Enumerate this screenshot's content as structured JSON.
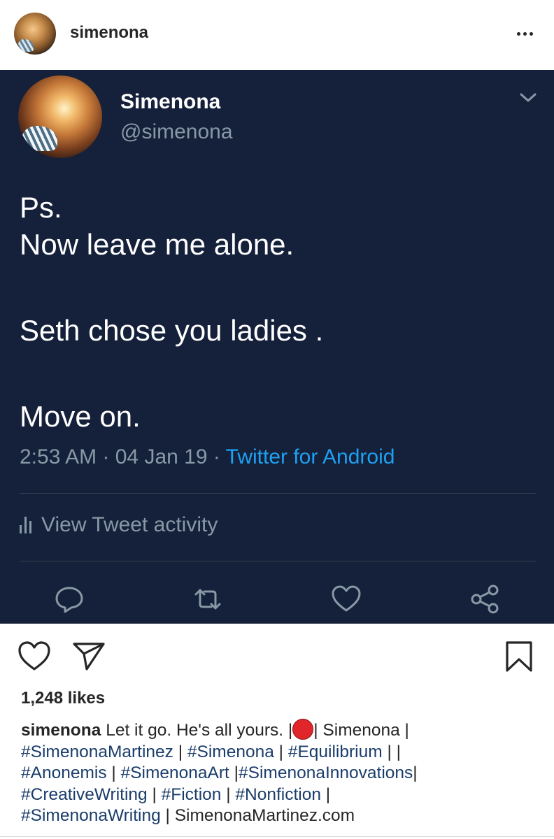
{
  "ig": {
    "username": "simenona",
    "likes": "1,248 likes"
  },
  "tweet": {
    "name": "Simenona",
    "handle": "@simenona",
    "lines": [
      "Ps.",
      "Now leave me alone.",
      "Seth chose you ladies .",
      "Move on."
    ],
    "time": "2:53 AM",
    "date": "04 Jan 19",
    "source": "Twitter for Android",
    "activity_label": "View Tweet activity",
    "separator": " · "
  },
  "caption": {
    "username": "simenona",
    "text1": "Let it go. He's all yours. |",
    "text2": "| Simenona |",
    "tag_martinez": "#SimenonaMartinez",
    "sep1": " | ",
    "tag_simenona": "#Simenona",
    "sep2": " | ",
    "tag_equilibrium": "#Equilibrium",
    "sep3": " | |",
    "tag_anonemis": "#Anonemis",
    "sep4": " | ",
    "tag_art": "#SimenonaArt",
    "sep5": " |",
    "tag_innovations": "#SimenonaInnovations",
    "sep6": "|",
    "tag_creative": "#CreativeWriting",
    "sep7": " | ",
    "tag_fiction": "#Fiction",
    "sep8": " | ",
    "tag_nonfiction": "#Nonfiction",
    "sep9": " |",
    "tag_writing": "#SimenonaWriting",
    "sep10": " | SimenonaMartinez.com"
  },
  "colors": {
    "tweet_bg": "#15203a",
    "twitter_blue": "#1da1f2",
    "muted": "#8899a6",
    "hashtag": "#1b3d6b",
    "red_dot": "#e0262b"
  },
  "icons": [
    "more-icon",
    "chevron-down-icon",
    "reply-icon",
    "retweet-icon",
    "like-icon",
    "share-icon",
    "heart-icon",
    "send-icon",
    "bookmark-icon",
    "bar-chart-icon",
    "red-circle-emoji"
  ]
}
